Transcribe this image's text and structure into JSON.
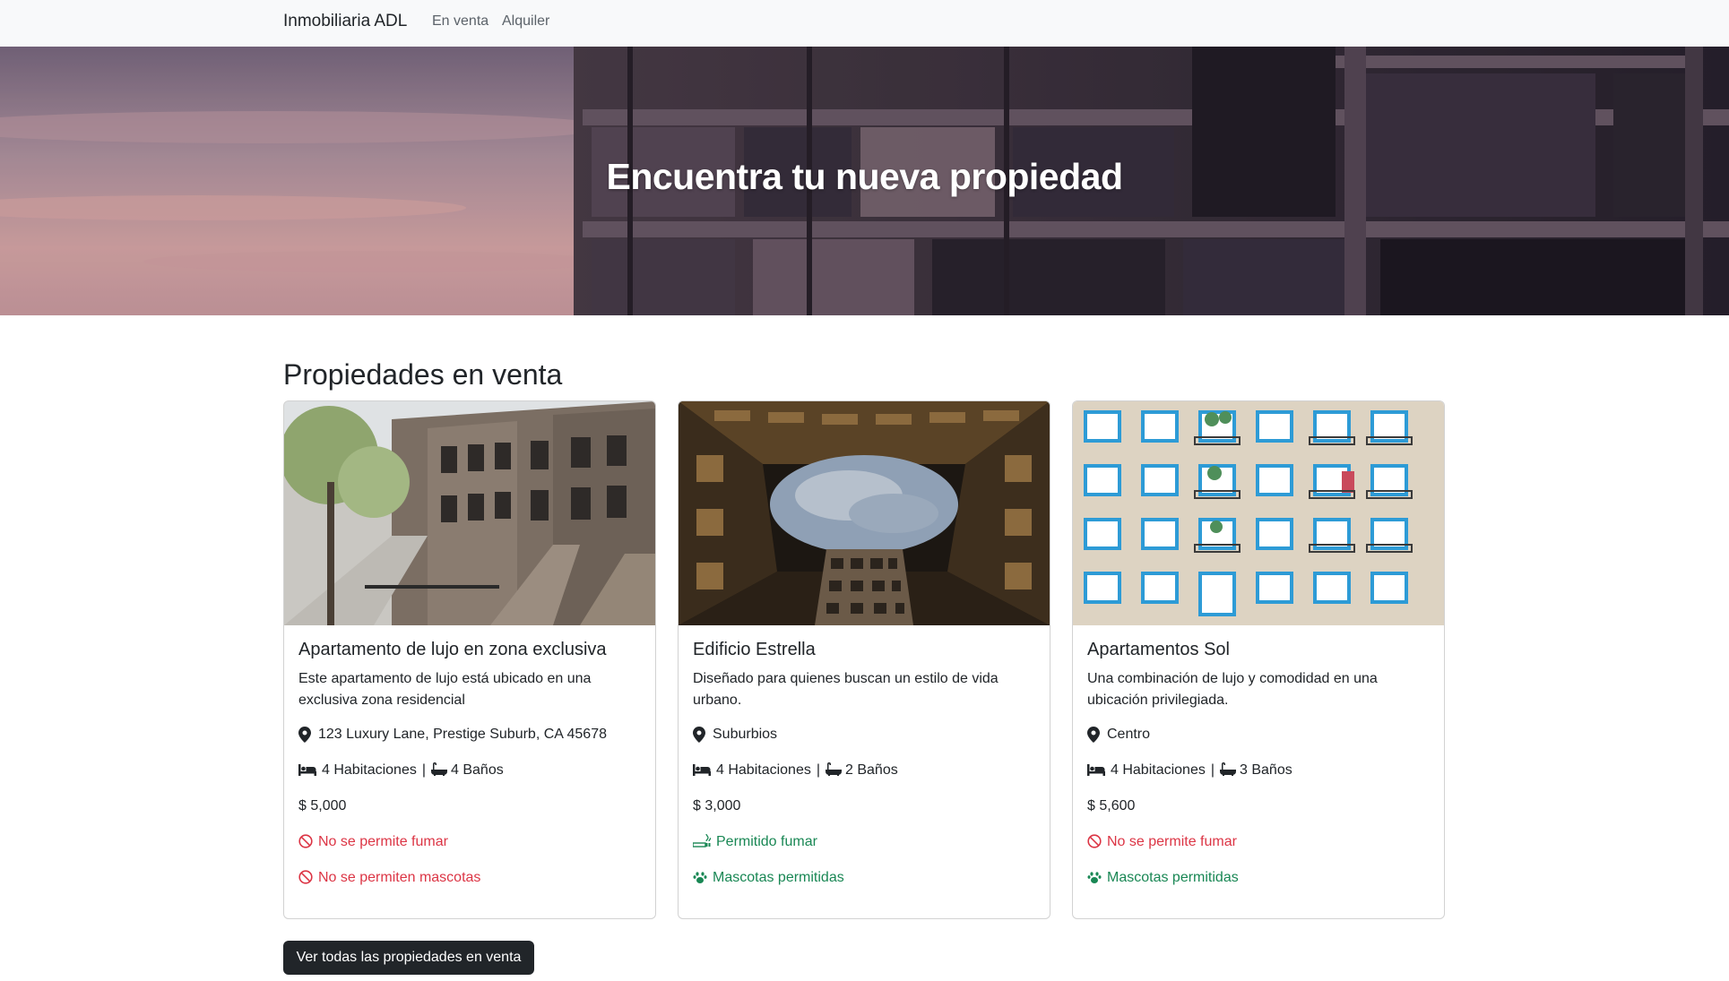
{
  "navbar": {
    "brand": "Inmobiliaria ADL",
    "links": [
      "En venta",
      "Alquiler"
    ]
  },
  "hero": {
    "title": "Encuentra tu nueva propiedad"
  },
  "section": {
    "title": "Propiedades en venta"
  },
  "properties": [
    {
      "title": "Apartamento de lujo en zona exclusiva",
      "description": "Este apartamento de lujo está ubicado en una exclusiva zona residencial",
      "location": "123 Luxury Lane, Prestige Suburb, CA 45678",
      "bedrooms": "4 Habitaciones",
      "bathrooms": "4 Baños",
      "price": "$ 5,000",
      "smoking": "No se permite fumar",
      "pets": "No se permiten mascotas"
    },
    {
      "title": "Edificio Estrella",
      "description": "Diseñado para quienes buscan un estilo de vida urbano.",
      "location": "Suburbios",
      "bedrooms": "4 Habitaciones",
      "bathrooms": "2 Baños",
      "price": "$ 3,000",
      "smoking": "Permitido fumar",
      "pets": "Mascotas permitidas"
    },
    {
      "title": "Apartamentos Sol",
      "description": "Una combinación de lujo y comodidad en una ubicación privilegiada.",
      "location": "Centro",
      "bedrooms": "4 Habitaciones",
      "bathrooms": "3 Baños",
      "price": "$ 5,600",
      "smoking": "No se permite fumar",
      "pets": "Mascotas permitidas"
    }
  ],
  "cta": {
    "label": "Ver todas las propiedades en venta"
  },
  "icons": {
    "location": "map-marker-icon",
    "bedrooms": "bed-icon",
    "bathrooms": "bath-icon",
    "no_smoking": "ban-icon",
    "smoking": "smoking-icon",
    "no_pets": "ban-icon",
    "pets": "paw-icon"
  },
  "colors": {
    "navbar_bg": "#f8f9fa",
    "text": "#212529",
    "danger": "#dc3545",
    "success": "#198754",
    "button_bg": "#212529"
  }
}
